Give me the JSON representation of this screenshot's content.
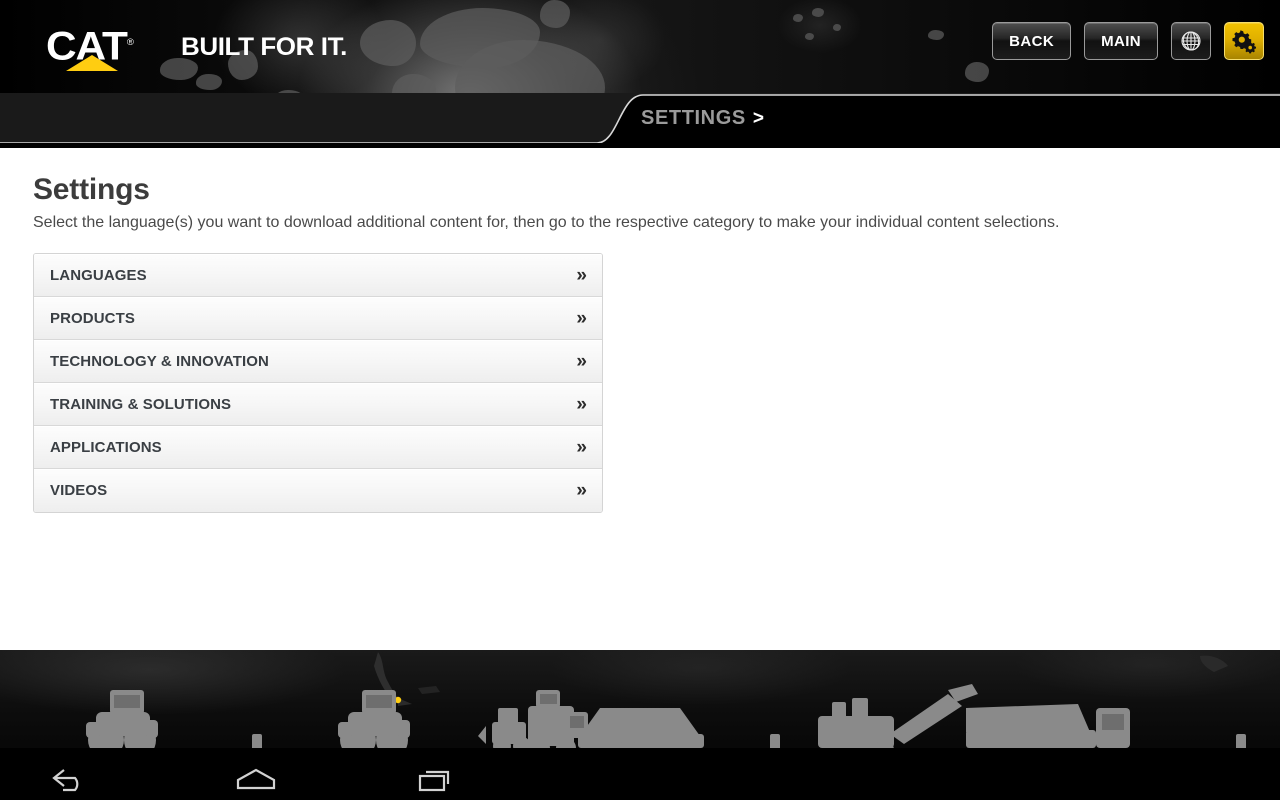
{
  "brand": {
    "logo_text": "CAT",
    "logo_registered": "®",
    "tagline": "BUILT FOR IT."
  },
  "header": {
    "buttons": [
      {
        "id": "back",
        "label": "BACK",
        "type": "text",
        "active": false
      },
      {
        "id": "main",
        "label": "MAIN",
        "type": "text",
        "active": false
      },
      {
        "id": "globe",
        "label": "",
        "icon": "globe-icon",
        "type": "icon",
        "active": false
      },
      {
        "id": "settings",
        "label": "",
        "icon": "gears-icon",
        "type": "icon",
        "active": true
      }
    ]
  },
  "breadcrumb": {
    "label": "SETTINGS",
    "separator": ">"
  },
  "main": {
    "title": "Settings",
    "subtitle": "Select the language(s) you want to download additional content for, then go to the respective category to make your individual content selections.",
    "list_items": [
      {
        "label": "LANGUAGES",
        "chevron": "»"
      },
      {
        "label": "PRODUCTS",
        "chevron": "»"
      },
      {
        "label": "TECHNOLOGY & INNOVATION",
        "chevron": "»"
      },
      {
        "label": "TRAINING & SOLUTIONS",
        "chevron": "»"
      },
      {
        "label": "APPLICATIONS",
        "chevron": "»"
      },
      {
        "label": "VIDEOS",
        "chevron": "»"
      }
    ]
  },
  "navbar": {
    "buttons": [
      {
        "id": "back",
        "icon": "android-back-icon"
      },
      {
        "id": "home",
        "icon": "android-home-icon"
      },
      {
        "id": "recents",
        "icon": "android-recents-icon"
      }
    ]
  },
  "colors": {
    "brand_yellow": "#ffcd11",
    "header_bg": "#0a0a0a",
    "page_bg": "#ffffff",
    "title_text": "#3c3c3c",
    "row_text": "#3a3f44",
    "crumb_text": "#9b9b9b",
    "active_button": "#e0b000"
  }
}
